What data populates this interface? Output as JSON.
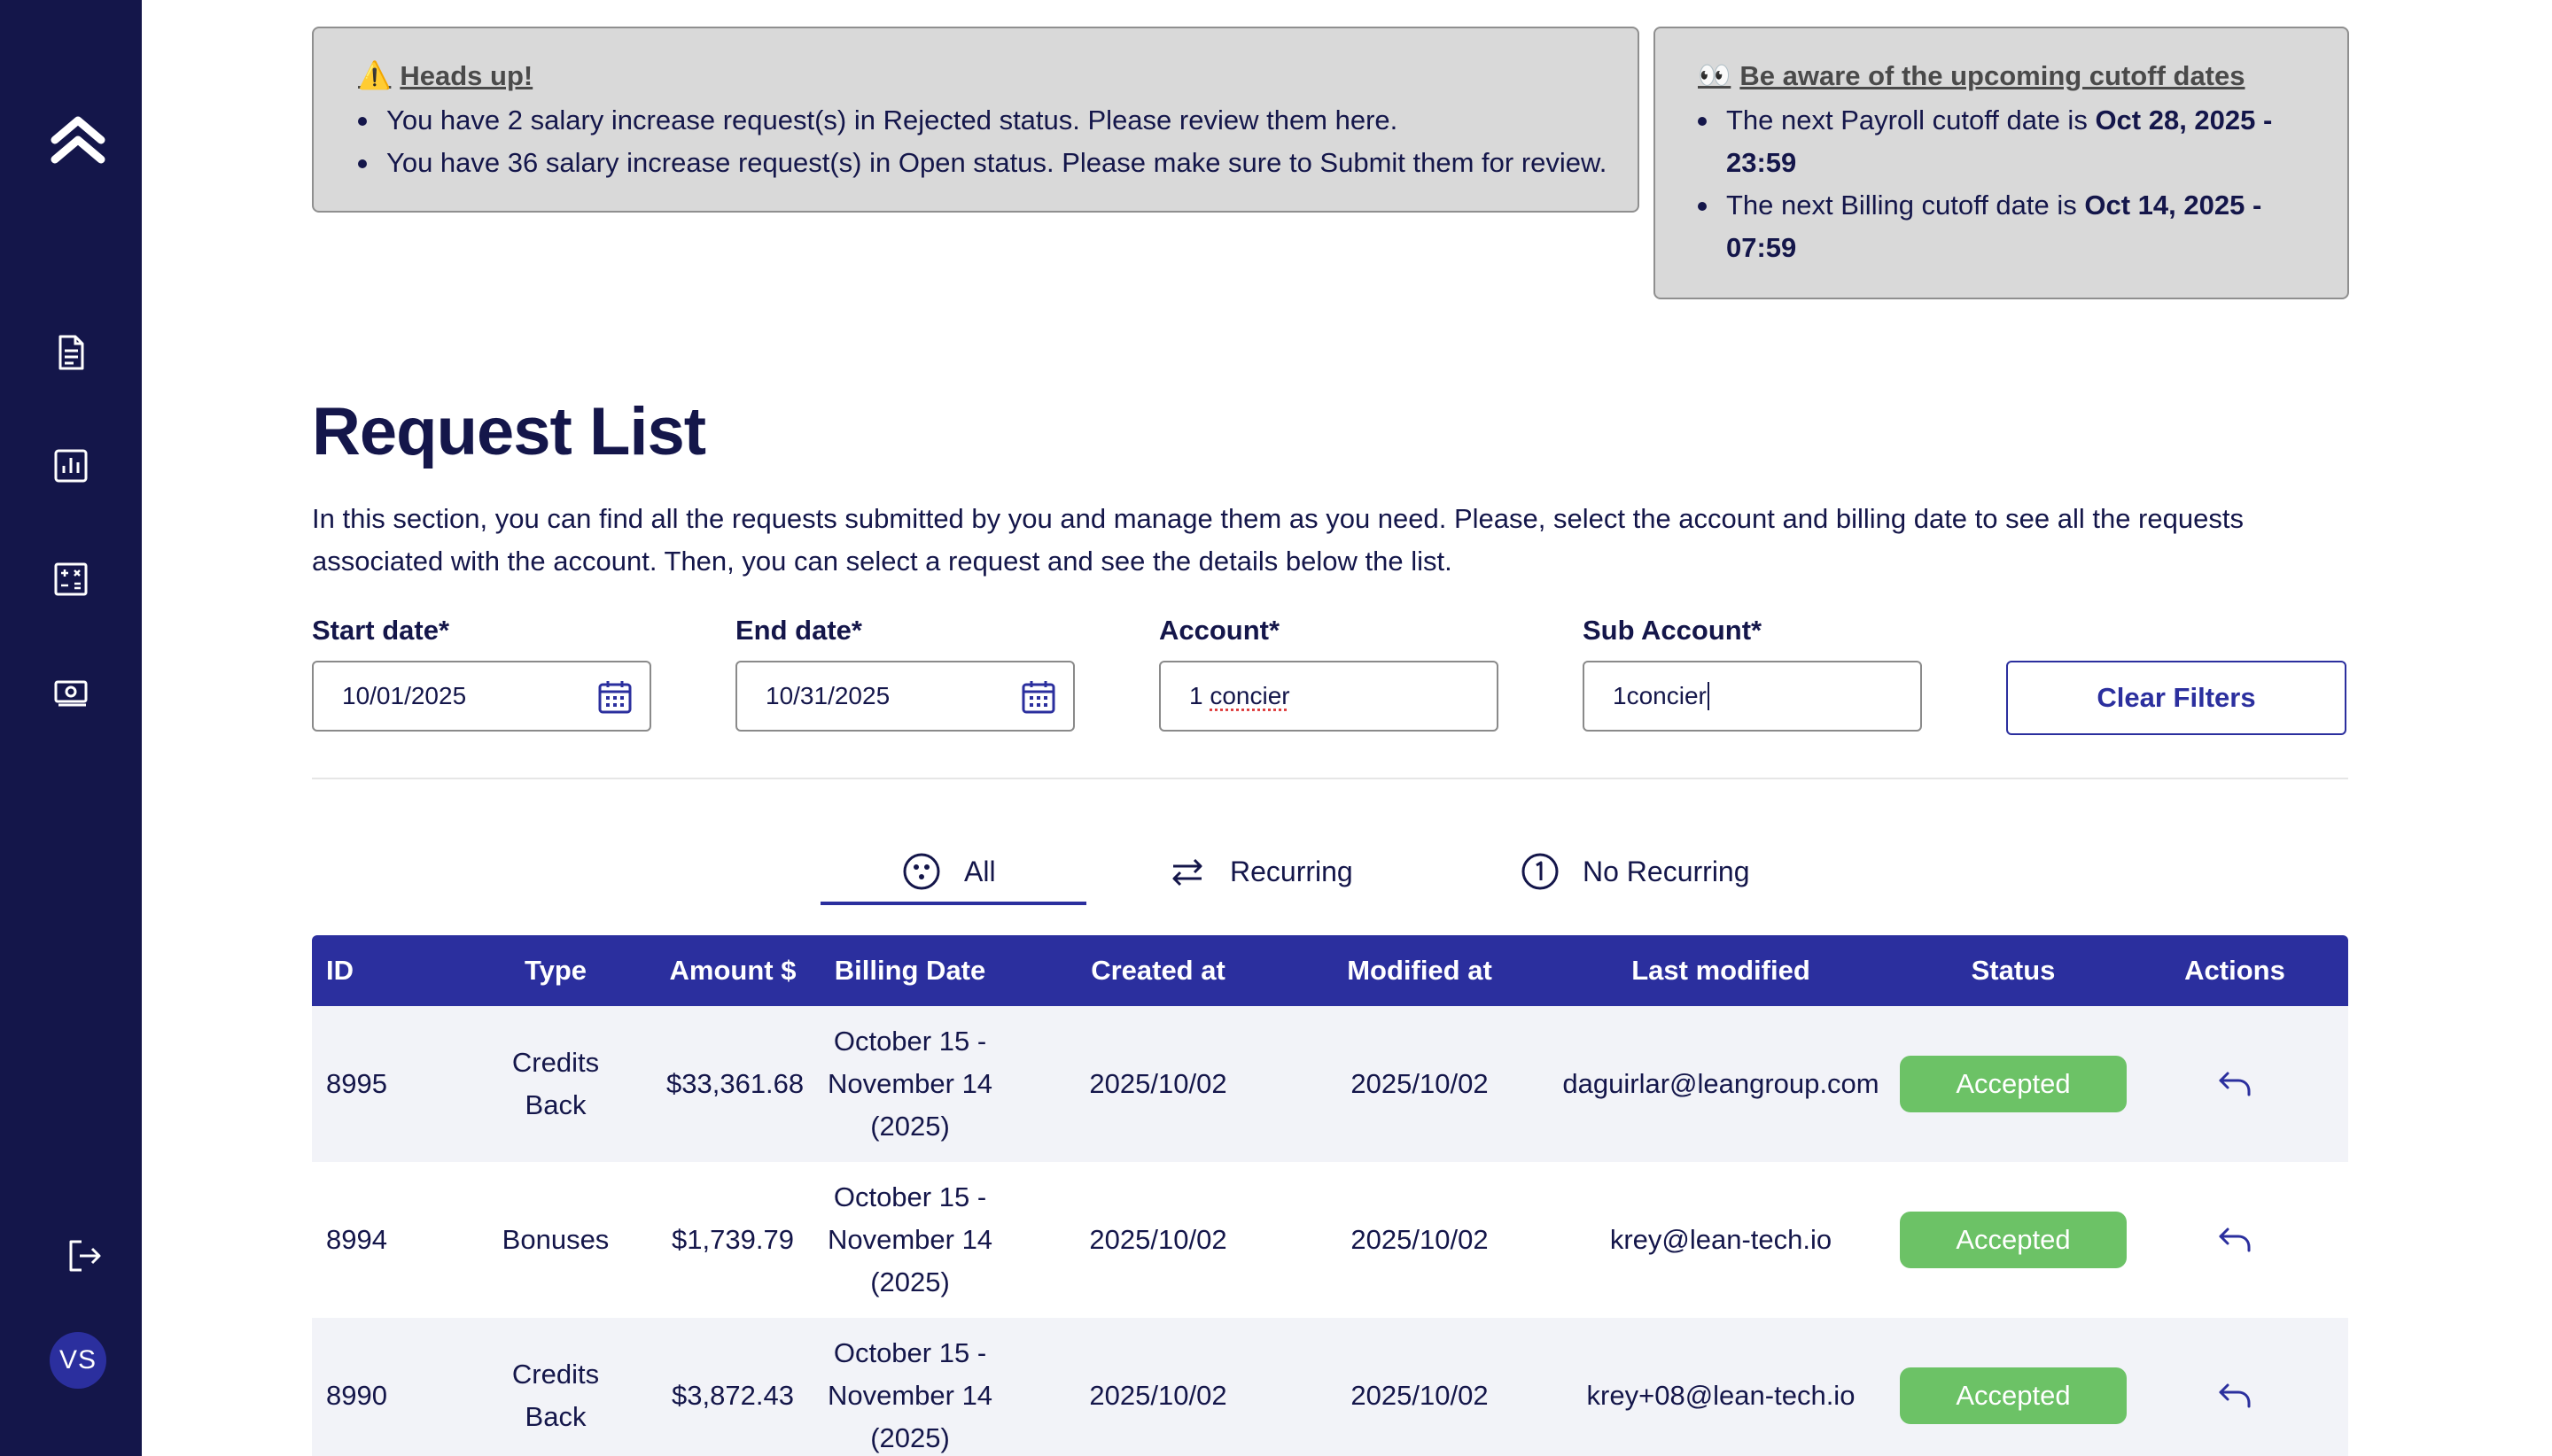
{
  "alerts": {
    "heads_up": {
      "icon": "warning-icon",
      "title": "Heads up!",
      "items": [
        "You have 2 salary increase request(s) in Rejected status. Please review them here.",
        "You have 36 salary increase request(s) in Open status. Please make sure to Submit them for review."
      ]
    },
    "cutoff": {
      "icon": "eyes-icon",
      "title": "Be aware of the upcoming cutoff dates",
      "payroll_prefix": "The next Payroll cutoff date is ",
      "payroll_date": "Oct 28, 2025 - 23:59",
      "billing_prefix": "The next Billing cutoff date is ",
      "billing_date": "Oct 14, 2025 - 07:59"
    }
  },
  "page": {
    "title": "Request List",
    "description": "In this section, you can find all the requests submitted by you and manage them as you need. Please, select the account and billing date to see all the requests associated with the account. Then, you can select a request and see the details below the list."
  },
  "filters": {
    "start_label": "Start date*",
    "start_value": "10/01/2025",
    "end_label": "End date*",
    "end_value": "10/31/2025",
    "account_label": "Account*",
    "account_value_prefix": "1 ",
    "account_value_word": "concier",
    "subaccount_label": "Sub Account*",
    "subaccount_value": "1concier",
    "clear_label": "Clear Filters"
  },
  "tabs": [
    {
      "label": "All",
      "icon": "all-icon",
      "active": true
    },
    {
      "label": "Recurring",
      "icon": "recurring-icon"
    },
    {
      "label": "No Recurring",
      "icon": "one-icon"
    }
  ],
  "table": {
    "headers": [
      "ID",
      "Type",
      "Amount $",
      "Billing Date",
      "Created at",
      "Modified at",
      "Last modified",
      "Status",
      "Actions"
    ],
    "rows": [
      {
        "id": "8995",
        "type_l1": "Credits",
        "type_l2": "Back",
        "amount": "$33,361.68",
        "bill_l1": "October 15 -",
        "bill_l2": "November 14",
        "bill_l3": "(2025)",
        "created": "2025/10/02",
        "modified": "2025/10/02",
        "last": "daguirlar@leangroup.com",
        "status": "Accepted"
      },
      {
        "id": "8994",
        "type_l1": "Bonuses",
        "type_l2": "",
        "amount": "$1,739.79",
        "bill_l1": "October 15 -",
        "bill_l2": "November 14",
        "bill_l3": "(2025)",
        "created": "2025/10/02",
        "modified": "2025/10/02",
        "last": "krey@lean-tech.io",
        "status": "Accepted"
      },
      {
        "id": "8990",
        "type_l1": "Credits",
        "type_l2": "Back",
        "amount": "$3,872.43",
        "bill_l1": "October 15 -",
        "bill_l2": "November 14",
        "bill_l3": "(2025)",
        "created": "2025/10/02",
        "modified": "2025/10/02",
        "last": "krey+08@lean-tech.io",
        "status": "Accepted"
      }
    ]
  },
  "sidebar": {
    "items": [
      "logo-icon",
      "document-icon",
      "chart-icon",
      "calculator-icon",
      "money-icon",
      "logout-icon"
    ],
    "avatar": "VS"
  },
  "colors": {
    "sidebar": "#14164a",
    "primary": "#2b2f9e",
    "accepted": "#6cc266",
    "alert_bg": "#d9d9d9"
  }
}
